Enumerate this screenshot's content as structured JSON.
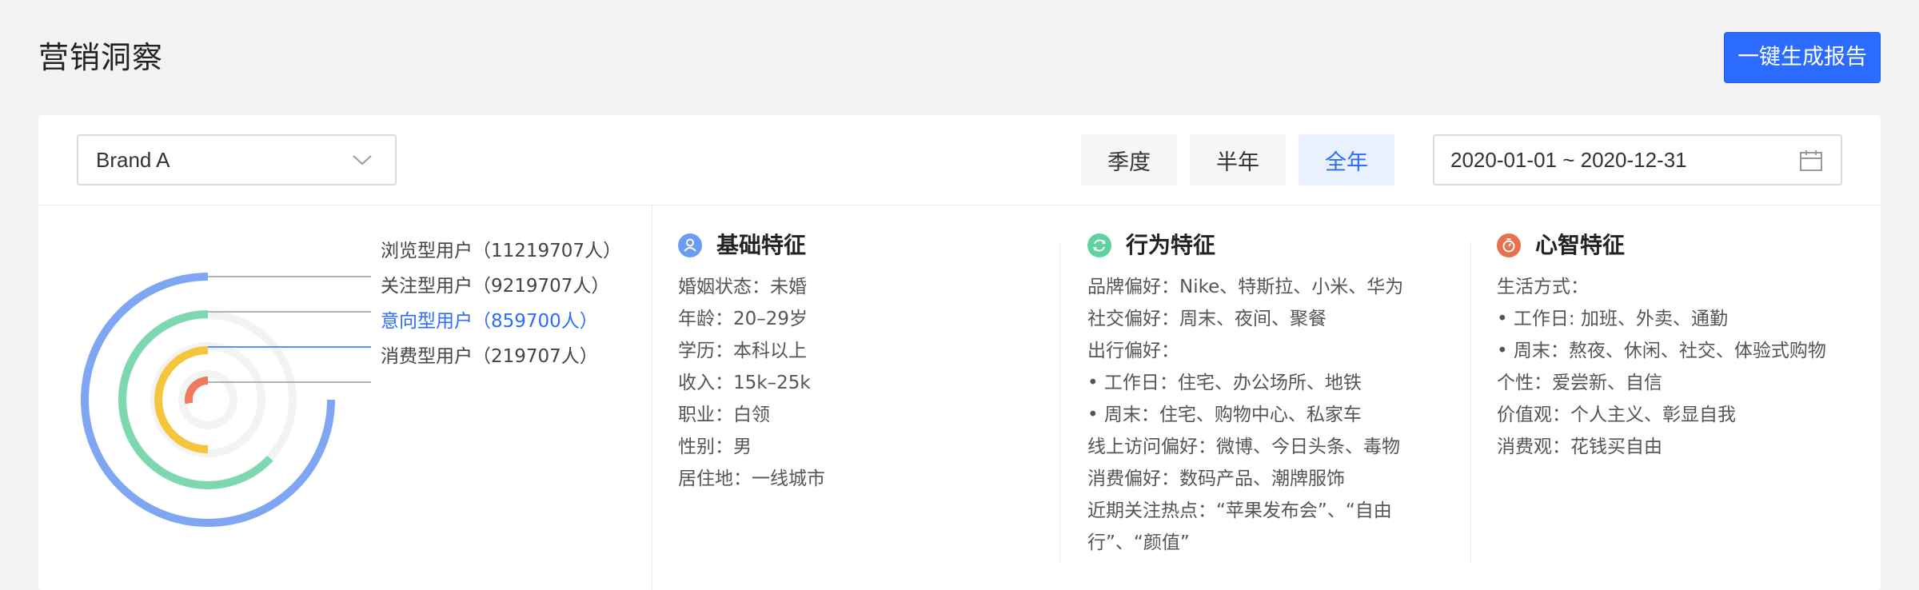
{
  "header": {
    "title": "营销洞察",
    "report_button": "一键生成报告"
  },
  "filters": {
    "brand": "Brand A",
    "periods": [
      "季度",
      "半年",
      "全年"
    ],
    "active_period": "全年",
    "date_range": "2020-01-01 ~ 2020-12-31"
  },
  "funnel": {
    "levels": [
      {
        "label": "浏览型用户（11219707人）",
        "color": "#7fa6f2",
        "fill": 0.75,
        "highlight": false
      },
      {
        "label": "关注型用户（9219707人）",
        "color": "#7dd8b0",
        "fill": 0.63,
        "highlight": false
      },
      {
        "label": "意向型用户（859700人）",
        "color": "#f5c63c",
        "fill": 0.5,
        "highlight": true
      },
      {
        "label": "消费型用户（219707人）",
        "color": "#ec7b5f",
        "fill": 0.28,
        "highlight": false
      }
    ]
  },
  "features": [
    {
      "title": "基础特征",
      "icon": "user-icon",
      "icon_color": "#6b9cf5",
      "rows": [
        "婚姻状态：未婚",
        "年龄：20–29岁",
        "学历：本科以上",
        "收入：15k–25k",
        "职业：白领",
        "性别：男",
        "居住地：一线城市"
      ]
    },
    {
      "title": "行为特征",
      "icon": "refresh-icon",
      "icon_color": "#5ed3a0",
      "rows": [
        "品牌偏好：Nike、特斯拉、小米、华为",
        "社交偏好：周末、夜间、聚餐",
        "出行偏好：",
        "• 工作日：住宅、办公场所、地铁",
        "• 周末：住宅、购物中心、私家车",
        "线上访问偏好：微博、今日头条、毒物",
        "消费偏好：数码产品、潮牌服饰",
        "近期关注热点：“苹果发布会”、“自由行”、“颜值”"
      ]
    },
    {
      "title": "心智特征",
      "icon": "timer-icon",
      "icon_color": "#e8704f",
      "rows": [
        "生活方式：",
        "• 工作日: 加班、外卖、通勤",
        "• 周末：熬夜、休闲、社交、体验式购物",
        "个性：爱尝新、自信",
        "价值观：个人主义、彰显自我",
        "消费观：花钱买自由"
      ]
    }
  ]
}
